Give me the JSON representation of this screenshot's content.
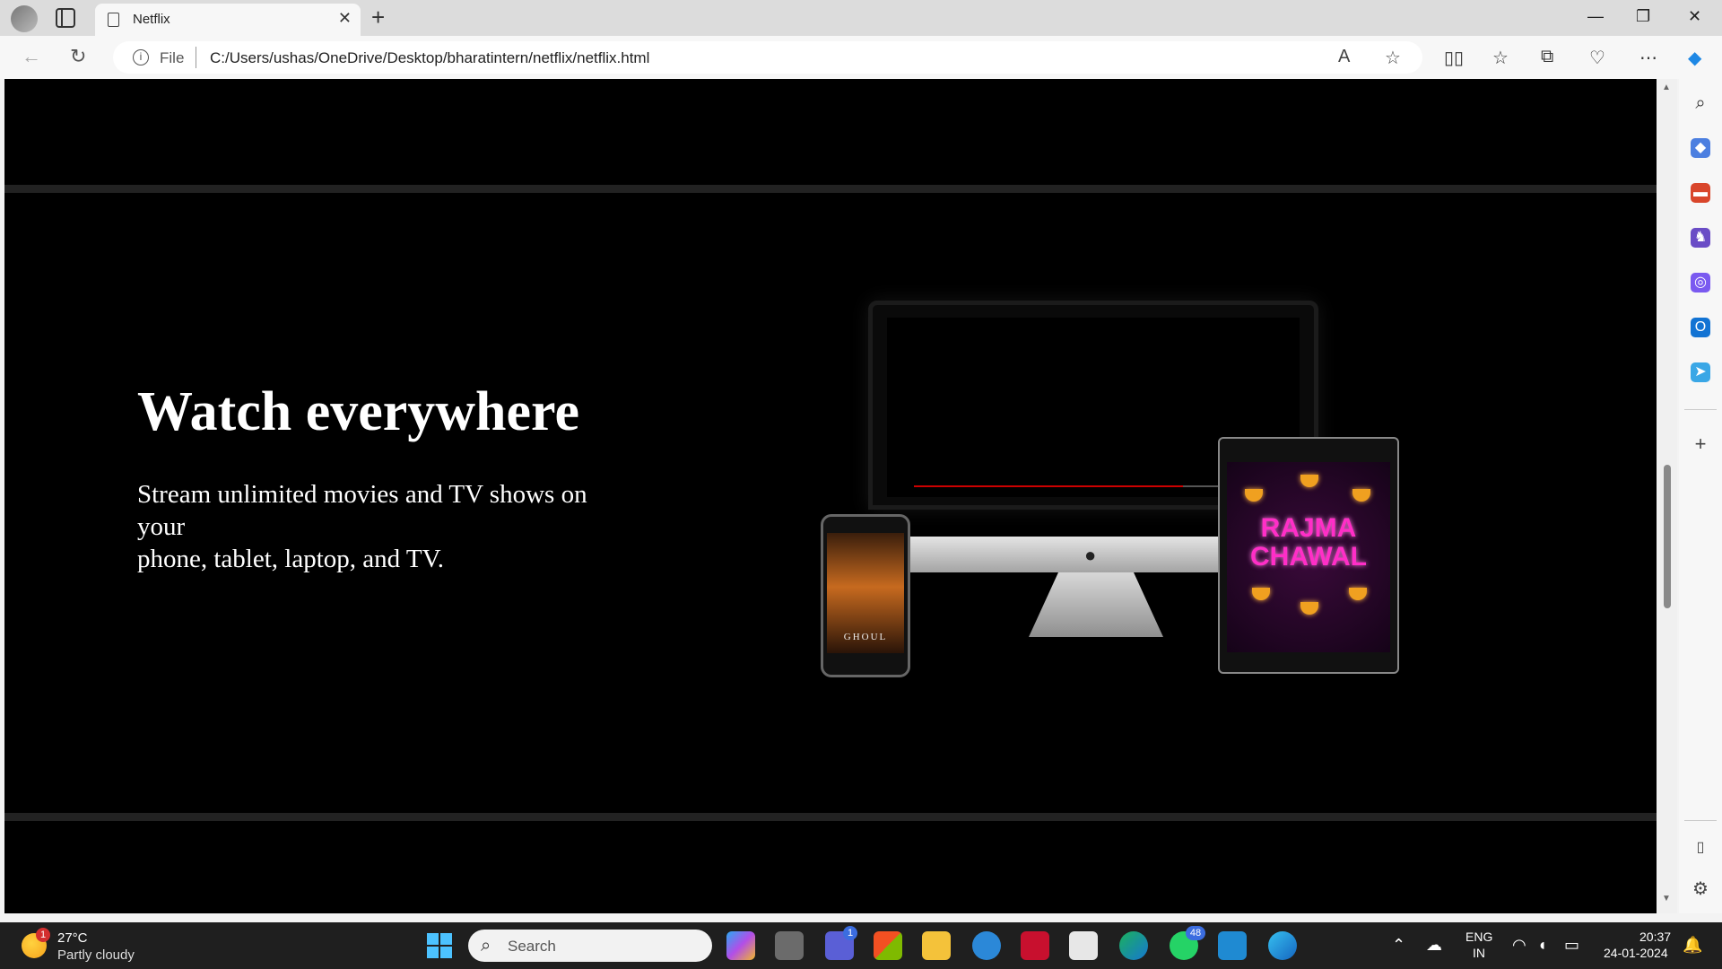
{
  "browser": {
    "tab_title": "Netflix",
    "tab_close": "✕",
    "new_tab": "+",
    "window_controls": {
      "minimize": "—",
      "maximize": "❐",
      "close": "✕"
    },
    "url_scheme": "File",
    "url": "C:/Users/ushas/OneDrive/Desktop/bharatintern/netflix/netflix.html",
    "icons": [
      "back-icon",
      "refresh-icon",
      "info-icon",
      "read-aloud-icon",
      "favorite-star-icon",
      "split-screen-icon",
      "favorites-icon",
      "collections-icon",
      "browser-essentials-icon",
      "more-icon",
      "copilot-icon"
    ]
  },
  "sidebar": {
    "icons": [
      "search-icon",
      "shopping-icon",
      "tools-icon",
      "games-icon",
      "microsoft-365-icon",
      "outlook-icon",
      "telegram-icon",
      "add-icon",
      "sidebar-toggle-icon",
      "settings-icon"
    ]
  },
  "page": {
    "title": "Watch everywhere",
    "line1": "Stream unlimited movies and TV shows on your",
    "line2": "phone, tablet, laptop, and TV.",
    "phone_poster_title": "GHOUL",
    "tablet_poster_title_1": "RAJMA",
    "tablet_poster_title_2": "CHAWAL"
  },
  "taskbar": {
    "weather_badge": "1",
    "weather_temp": "27°C",
    "weather_desc": "Partly cloudy",
    "search_label": "Search",
    "teams_badge": "1",
    "whatsapp_badge": "48",
    "language": "ENG",
    "region": "IN",
    "time": "20:37",
    "date": "24-01-2024",
    "apps": [
      "start-icon",
      "copilot-app-icon",
      "task-view-icon",
      "teams-icon",
      "store-icon",
      "file-explorer-icon",
      "get-help-icon",
      "mcafee-icon",
      "snipping-tool-icon",
      "edge-dev-icon",
      "whatsapp-icon",
      "vscode-icon",
      "edge-icon"
    ]
  }
}
